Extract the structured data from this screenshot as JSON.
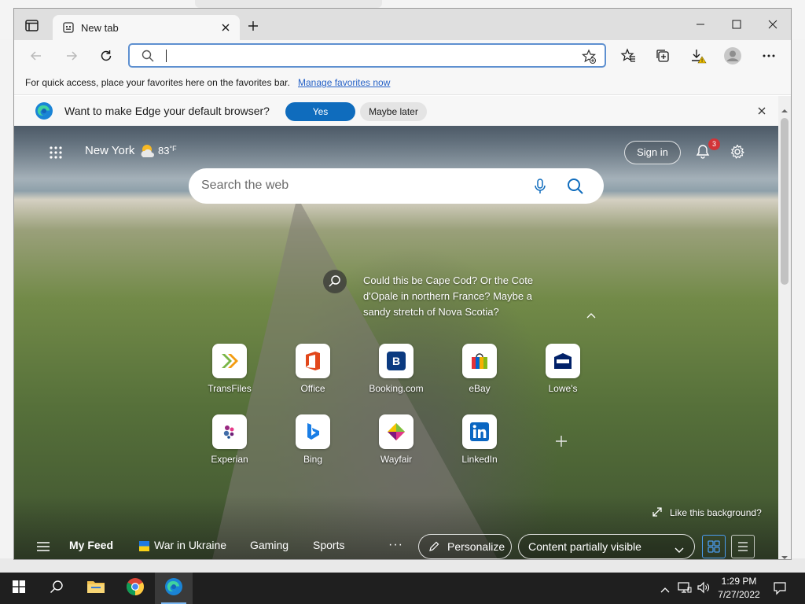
{
  "browser": {
    "tab_title": "New tab",
    "favorites_bar_message": "For quick access, place your favorites here on the favorites bar.",
    "favorites_bar_link": "Manage favorites now",
    "default_prompt": {
      "question": "Want to make Edge your default browser?",
      "yes_label": "Yes",
      "later_label": "Maybe later"
    }
  },
  "newtab": {
    "city": "New York",
    "temperature": "83",
    "temperature_unit": "°F",
    "sign_in_label": "Sign in",
    "notification_count": "3",
    "search_placeholder": "Search the web",
    "caption": "Could this be Cape Cod? Or the Cote d'Opale in northern France? Maybe a sandy stretch of Nova Scotia?",
    "quick_links": [
      {
        "label": "TransFiles"
      },
      {
        "label": "Office"
      },
      {
        "label": "Booking.com"
      },
      {
        "label": "eBay"
      },
      {
        "label": "Lowe's"
      },
      {
        "label": "Experian"
      },
      {
        "label": "Bing"
      },
      {
        "label": "Wayfair"
      },
      {
        "label": "LinkedIn"
      }
    ],
    "like_background": "Like this background?",
    "feed": {
      "my_feed": "My Feed",
      "tabs": [
        "War in Ukraine",
        "Gaming",
        "Sports"
      ],
      "more": "···",
      "personalize": "Personalize",
      "content_visibility": "Content partially visible"
    }
  },
  "taskbar": {
    "time": "1:29 PM",
    "date": "7/27/2022"
  },
  "colors": {
    "accent": "#0f6cbd",
    "link": "#2662c7",
    "taskbar": "#1f1f1f"
  }
}
